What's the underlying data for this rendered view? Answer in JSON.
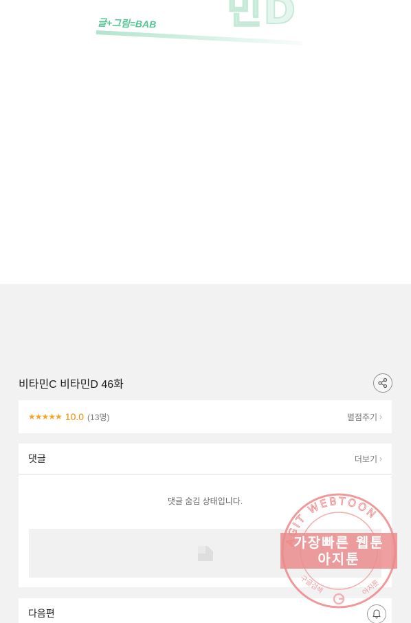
{
  "comic": {
    "title_art_letters": "민D",
    "credit": "글+그림=BAB"
  },
  "episode": {
    "title": "비타민C 비타민D 46화",
    "share_icon": "share-icon"
  },
  "rating": {
    "stars": "★★★★★",
    "score": "10.0",
    "count": "(13명)",
    "rate_link": "별점주기",
    "chevron": "›"
  },
  "comments": {
    "heading": "댓글",
    "more_link": "더보기",
    "chevron": "›",
    "hidden_notice": "댓글 숨김 상태입니다."
  },
  "next_episode": {
    "label": "다음편",
    "alarm_icon": "bell-icon"
  },
  "watermark": {
    "ring_text": "AGIT WEBTOON",
    "line1": "가장빠른 웹툰",
    "line2": "아지툰",
    "left_small": "구글검색",
    "right_small": "아지툰",
    "color": "#e8797a"
  },
  "colors": {
    "accent_green": "#39b97a",
    "star_orange": "#f5a623",
    "score_orange": "#ee8a00",
    "background": "#f2f2f3"
  }
}
